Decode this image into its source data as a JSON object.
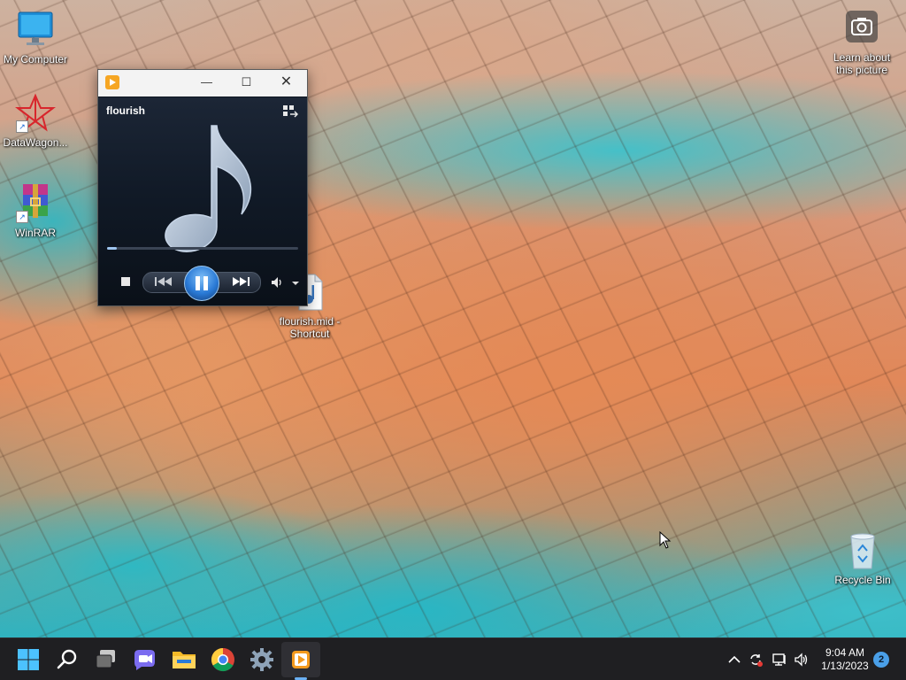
{
  "desktop": {
    "icons": [
      {
        "label": "My Computer",
        "icon": "monitor-icon"
      },
      {
        "label": "DataWagon...",
        "icon": "datawagon-icon"
      },
      {
        "label": "WinRAR",
        "icon": "winrar-icon"
      },
      {
        "label": "flourish.mid - Shortcut",
        "icon": "midi-file-icon"
      },
      {
        "label": "Learn about this picture",
        "icon": "camera-icon"
      },
      {
        "label": "Recycle Bin",
        "icon": "recycle-bin-icon"
      }
    ]
  },
  "player": {
    "track_title": "flourish",
    "progress_fraction": 0.05,
    "titlebar": {
      "minimize": "—",
      "maximize": "☐",
      "close": "✕"
    }
  },
  "taskbar": {
    "apps": [
      {
        "name": "Start",
        "icon": "windows-start-icon"
      },
      {
        "name": "Search",
        "icon": "search-icon"
      },
      {
        "name": "Task View",
        "icon": "task-view-icon"
      },
      {
        "name": "Chat",
        "icon": "chat-icon"
      },
      {
        "name": "File Explorer",
        "icon": "folder-icon"
      },
      {
        "name": "Chrome",
        "icon": "chrome-icon"
      },
      {
        "name": "Settings",
        "icon": "gear-icon"
      },
      {
        "name": "Media Player",
        "icon": "media-player-icon"
      }
    ],
    "clock": {
      "time": "9:04 AM",
      "date": "1/13/2023"
    },
    "notification_count": "2"
  }
}
